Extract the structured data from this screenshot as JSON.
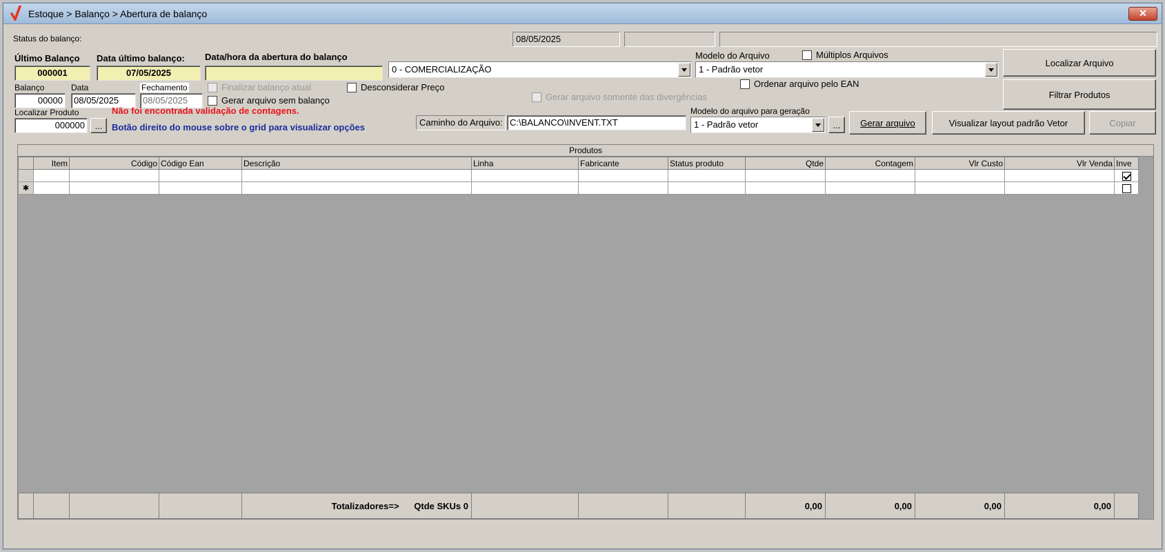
{
  "window": {
    "title": "Estoque > Balanço > Abertura de balanço",
    "close_label": "✕"
  },
  "status": {
    "label": "Status do balanço:",
    "date": "08/05/2025",
    "panel2": "",
    "panel3": ""
  },
  "ultimo_balanco": {
    "label": "Último Balanço",
    "value": "000001"
  },
  "data_ultimo": {
    "label": "Data último balanço:",
    "value": "07/05/2025"
  },
  "abertura": {
    "label": "Data/hora da abertura do balanço",
    "value": ""
  },
  "finalidade": {
    "selected": "0 - COMERCIALIZAÇÃO"
  },
  "modelo_arquivo": {
    "label": "Modelo do Arquivo",
    "selected": "1 - Padrão vetor"
  },
  "multiplos": {
    "label": "Múltiplos Arquivos",
    "checked": false
  },
  "buttons": {
    "localizar_arquivo": "Localizar Arquivo",
    "filtrar_produtos": "Filtrar Produtos",
    "gerar_arquivo": "Gerar arquivo",
    "visualizar_layout": "Visualizar layout padrão Vetor",
    "copiar": "Copiar",
    "ellipsis": "...",
    "ellipsis2": "..."
  },
  "balanco": {
    "label": "Balanço",
    "value": "00000"
  },
  "data": {
    "label": "Data",
    "value": "08/05/2025"
  },
  "fechamento": {
    "label": "Fechamento",
    "value": "08/05/2025"
  },
  "checks": {
    "finalizar": "Finalizar balanço atual",
    "gerar_sem": "Gerar arquivo sem balanço",
    "desconsiderar": "Desconsiderar Preço",
    "ordenar_ean": "Ordenar arquivo pelo EAN",
    "somente_div": "Gerar arquivo somente das divergências"
  },
  "localizar_produto": {
    "label": "Localizar Produto",
    "value": "000000"
  },
  "messages": {
    "erro": "Não foi encontrada validação de contagens.",
    "dica": "Botão direito do mouse sobre o grid para visualizar opções"
  },
  "caminho": {
    "label": "Caminho do Arquivo:",
    "value": "C:\\BALANCO\\INVENT.TXT"
  },
  "modelo_geracao": {
    "label": "Modelo do arquivo para geração",
    "selected": "1 - Padrão vetor"
  },
  "grid": {
    "caption": "Produtos",
    "columns": [
      "Item",
      "Código",
      "Código Ean",
      "Descrição",
      "Linha",
      "Fabricante",
      "Status produto",
      "Qtde",
      "Contagem",
      "Vlr Custo",
      "Vlr Venda",
      "Inve"
    ],
    "rows": [
      {
        "indicator": "",
        "inve_checked": true
      },
      {
        "indicator": "✱",
        "inve_checked": false
      }
    ],
    "totals": {
      "label": "Totalizadores=>",
      "skus": "Qtde SKUs 0",
      "qtde": "0,00",
      "contagem": "0,00",
      "custo": "0,00",
      "venda": "0,00"
    }
  },
  "colors": {
    "accent_red": "#e8141a",
    "accent_blue": "#1c2c9c",
    "field_yellow": "#f2efb2"
  }
}
